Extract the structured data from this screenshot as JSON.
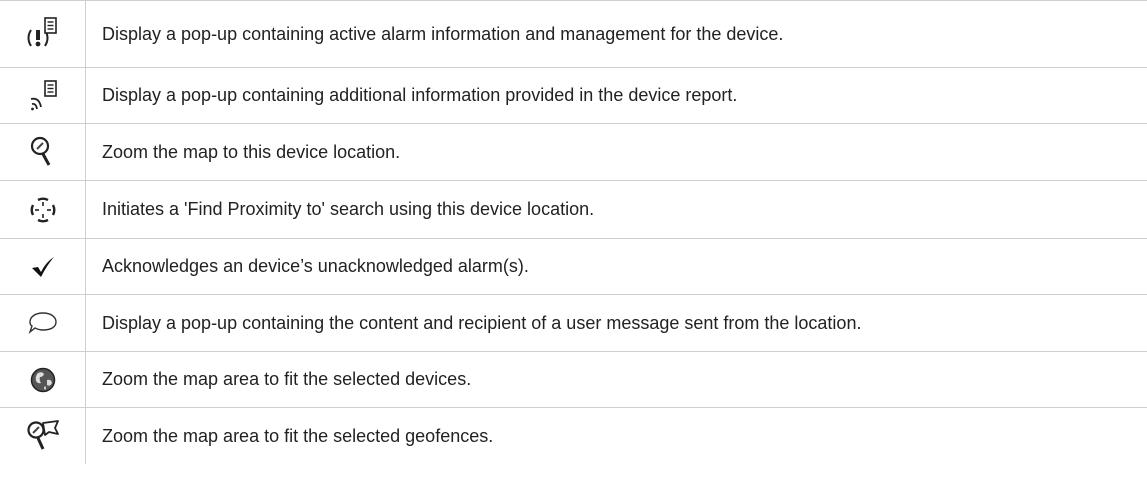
{
  "rows": [
    {
      "icon": "alarm-info-icon",
      "text": "Display a pop-up containing active alarm information and management for the device."
    },
    {
      "icon": "report-info-icon",
      "text": "Display a pop-up containing additional information provided in the device report."
    },
    {
      "icon": "zoom-device-icon",
      "text": "Zoom the map to this device location."
    },
    {
      "icon": "proximity-search-icon",
      "text": "Initiates a 'Find Proximity to' search using this device location."
    },
    {
      "icon": "checkmark-icon",
      "text": "Acknowledges an device’s unacknowledged alarm(s)."
    },
    {
      "icon": "speech-bubble-icon",
      "text": "Display a pop-up containing the content and recipient of a user message sent from the location."
    },
    {
      "icon": "globe-icon",
      "text": "Zoom the map area to fit the selected devices."
    },
    {
      "icon": "zoom-geofence-icon",
      "text": "Zoom the map area to fit the selected geofences."
    }
  ]
}
